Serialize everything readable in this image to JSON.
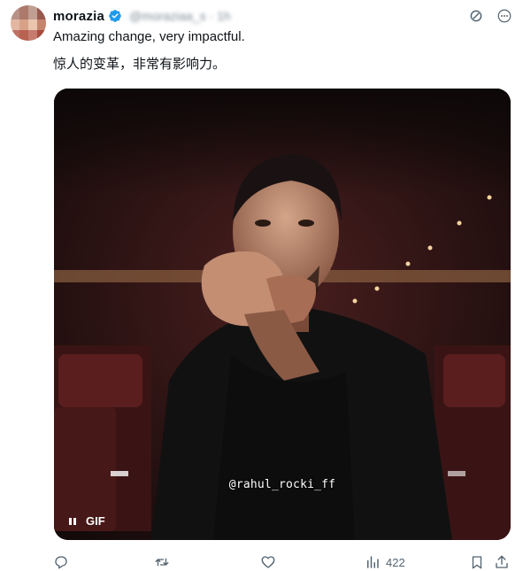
{
  "author": {
    "display_name": "morazia",
    "handle": "@moraziaa_s · 1h"
  },
  "tweet": {
    "text_en": "Amazing change, very impactful.",
    "text_zh": "惊人的变革，非常有影响力。"
  },
  "media": {
    "watermark": "@rahul_rocki_ff",
    "badge": "GIF"
  },
  "actions": {
    "views_count": "422"
  },
  "colors": {
    "verified": "#1d9bf0",
    "muted": "#536471",
    "text": "#0f1419"
  }
}
